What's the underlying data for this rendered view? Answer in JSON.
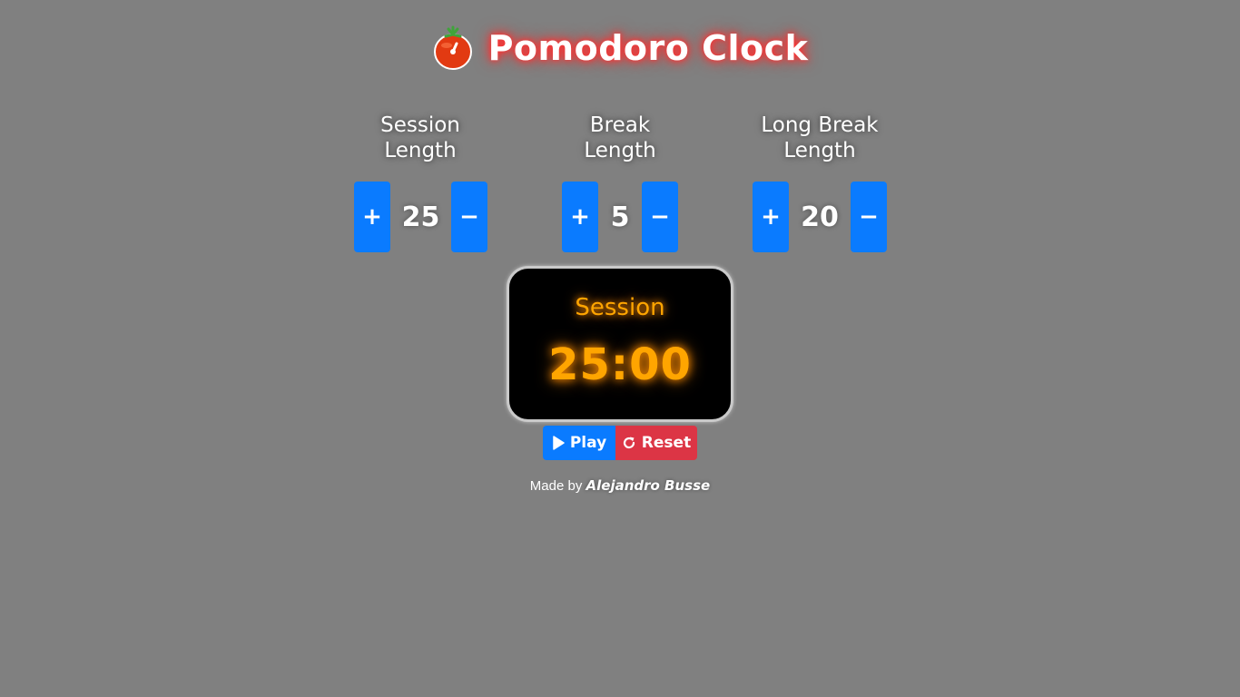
{
  "header": {
    "title": "Pomodoro Clock",
    "logo_icon": "tomato-icon"
  },
  "controls": [
    {
      "label_line1": "Session",
      "label_line2": "Length",
      "value": "25",
      "plus": "+",
      "minus": "−"
    },
    {
      "label_line1": "Break",
      "label_line2": "Length",
      "value": "5",
      "plus": "+",
      "minus": "−"
    },
    {
      "label_line1": "Long Break",
      "label_line2": "Length",
      "value": "20",
      "plus": "+",
      "minus": "−"
    }
  ],
  "timer": {
    "label": "Session",
    "time": "25:00"
  },
  "actions": {
    "play_label": "Play",
    "play_icon": "play-icon",
    "reset_label": "Reset",
    "reset_icon": "refresh-icon"
  },
  "footer": {
    "prefix": "Made by",
    "author": "Alejandro Busse"
  },
  "colors": {
    "background": "#808080",
    "accent_blue": "#0a7bff",
    "danger_red": "#dc3545",
    "timer_orange": "#ffa500",
    "title_glow": "#ff3030"
  }
}
